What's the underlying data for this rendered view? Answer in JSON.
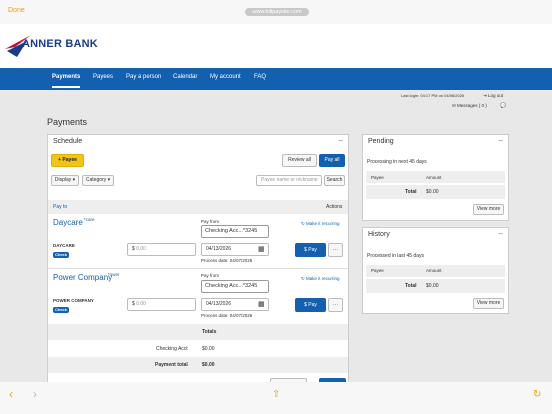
{
  "browser": {
    "done_label": "Done",
    "url": "www.billpaysite.com"
  },
  "brand": {
    "name": "ANNER BANK",
    "colors": {
      "primary": "#1360b0",
      "accent": "#f0c419",
      "logo_red": "#c8102e"
    }
  },
  "nav": {
    "items": [
      "Payments",
      "Payees",
      "Pay a person",
      "Calendar",
      "My account",
      "FAQ"
    ],
    "active": "Payments"
  },
  "session": {
    "last_login": "Last login: 04:17 PM on 04/06/2026",
    "logout": "Log out",
    "messages": "Messages ( 0 )"
  },
  "page_title": "Payments",
  "schedule": {
    "title": "Schedule",
    "add_payee": "Payee",
    "review_all": "Review all",
    "pay_all": "Pay all",
    "display": "Display",
    "category": "Category",
    "search_placeholder": "Payee name or nickname",
    "search": "Search",
    "col_pay_to": "Pay to",
    "col_actions": "Actions",
    "payees": [
      {
        "name": "Daycare",
        "nickname": "care",
        "label": "DAYCARE",
        "badge": "Check",
        "pay_from_label": "Pay from",
        "pay_from": "Checking Acc...*3245",
        "recurring": "Make it recurring",
        "amount_placeholder": "0.00",
        "date": "04/13/2026",
        "process_date": "Process date: 04/07/2026",
        "pay": "Pay"
      },
      {
        "name": "Power Company",
        "nickname": "ower",
        "label": "POWER COMPANY",
        "badge": "Check",
        "pay_from_label": "Pay from",
        "pay_from": "Checking Acc...*3245",
        "recurring": "Make it recurring",
        "amount_placeholder": "0.00",
        "date": "04/13/2026",
        "process_date": "Process date: 04/07/2026",
        "pay": "Pay"
      }
    ],
    "totals_label": "Totals",
    "checking_label": "Checking Acct",
    "checking_value": "$0.00",
    "payment_total_label": "Payment total",
    "payment_total_value": "$0.00",
    "currency": "$",
    "more": "···"
  },
  "pending": {
    "title": "Pending",
    "subtitle": "Processing in next 45 days",
    "col_payee": "Payee",
    "col_amount": "Amount",
    "total_label": "Total",
    "total_value": "$0.00",
    "view_more": "View more"
  },
  "history": {
    "title": "History",
    "subtitle": "Processed in last 45 days",
    "col_payee": "Payee",
    "col_amount": "Amount",
    "total_label": "Total",
    "total_value": "$0.00",
    "view_more": "View more"
  }
}
